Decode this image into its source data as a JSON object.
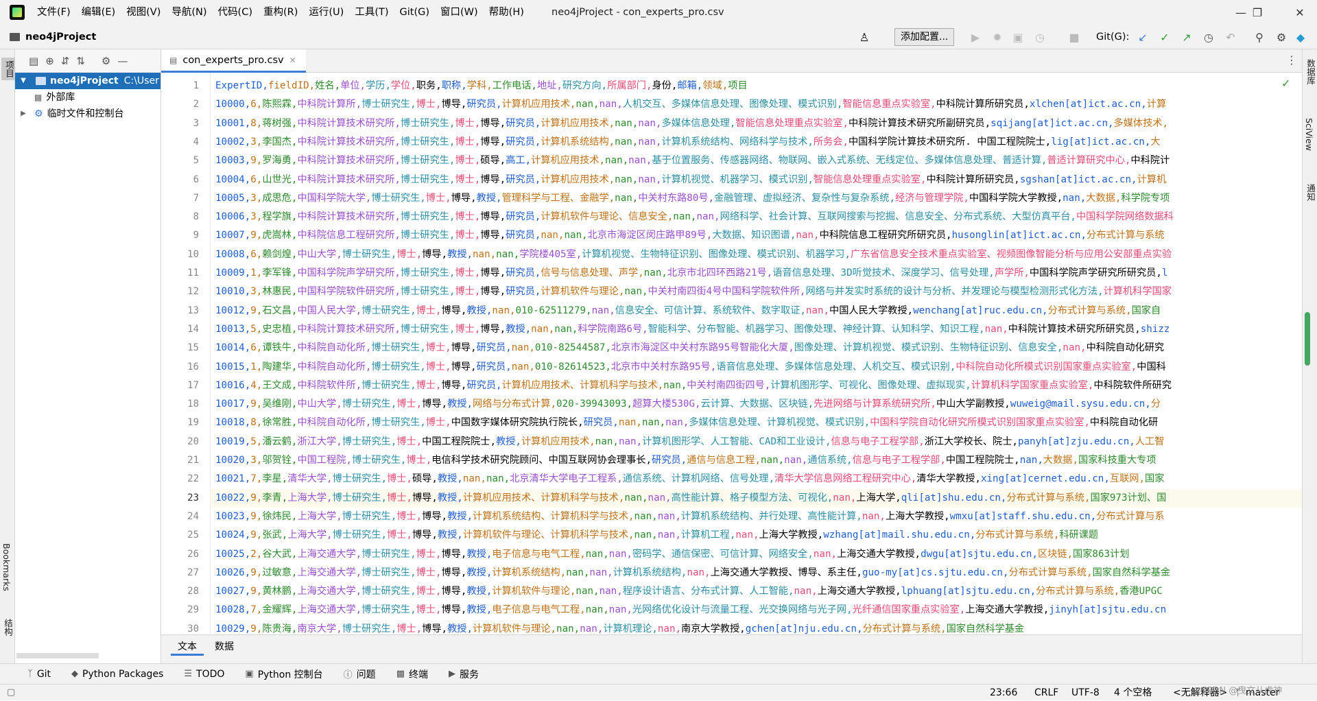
{
  "menubar": {
    "items": [
      "文件(F)",
      "编辑(E)",
      "视图(V)",
      "导航(N)",
      "代码(C)",
      "重构(R)",
      "运行(U)",
      "工具(T)",
      "Git(G)",
      "窗口(W)",
      "帮助(H)"
    ],
    "title": "neo4jProject - con_experts_pro.csv"
  },
  "navbar": {
    "project": "neo4jProject",
    "config_button": "添加配置...",
    "git_label": "Git(G):"
  },
  "left_strip": {
    "project": "项目",
    "bookmarks": "Bookmarks",
    "structure": "结构"
  },
  "right_strip": {
    "database": "数据库",
    "sciview": "SciView",
    "notifications": "通知"
  },
  "project_tree": {
    "root": "neo4jProject",
    "root_path": "C:\\User",
    "ext_libs": "外部库",
    "scratches": "临时文件和控制台"
  },
  "editor": {
    "file_tab": "con_experts_pro.csv",
    "current_line": 23,
    "lines": [
      "ExpertID,fieldID,姓名,单位,学历,学位,职务,职称,学科,工作电话,地址,研究方向,所属部门,身份,邮箱,领域,项目",
      "10000,6,陈熙霖,中科院计算所,博士研究生,博士,博导,研究员,计算机应用技术,nan,nan,人机交互、多媒体信息处理、图像处理、模式识别,智能信息重点实验室,中科院计算所研究员,xlchen[at]ict.ac.cn,计算",
      "10001,8,蒋树强,中科院计算技术研究所,博士研究生,博士,博导,研究员,计算机应用技术,nan,nan,多媒体信息处理,智能信息处理重点实验室,中科院计算技术研究所副研究员,sqijang[at]ict.ac.cn,多媒体技术,",
      "10002,3,李国杰,中科院计算技术研究所,博士研究生,博士,博导,研究员,计算机系统结构,nan,nan,计算机系统结构、网络科学与技术,所务会,中国科学院计算技术研究所. 中国工程院院士,lig[at]ict.ac.cn,大",
      "10003,9,罗海勇,中科院计算技术研究所,博士研究生,博士,硕导,高工,计算机应用技术,nan,nan,基于位置服务、传感器网络、物联网、嵌入式系统、无线定位、多媒体信息处理、普适计算,普适计算研究中心,中科院计",
      "10004,6,山世光,中科院计算技术研究所,博士研究生,博士,博导,研究员,计算机应用技术,nan,nan,计算机视觉、机器学习、模式识别,智能信息处理重点实验室,中科院计算所研究员,sgshan[at]ict.ac.cn,计算机",
      "10005,3,成思危,中国科学院大学,博士研究生,博士,博导,教授,管理科学与工程、金融学,nan,中关村东路80号,金融管理、虚拟经济、复杂性与复杂系统,经济与管理学院,中国科学院大学教授,nan,大数据,科学院专项",
      "10006,3,程学旗,中科院计算技术研究所,博士研究生,博士,博导,研究员,计算机软件与理论、信息安全,nan,nan,网络科学、社会计算、互联网搜索与挖掘、信息安全、分布式系统、大型仿真平台,中国科学院网络数据科",
      "10007,9,虎嵩林,中科院信息工程研究所,博士研究生,博士,博导,研究员,nan,nan,北京市海淀区闵庄路甲89号,大数据、知识图谱,nan,中科院信息工程研究所研究员,husonglin[at]ict.ac.cn,分布式计算与系统",
      "10008,6,赖剑煌,中山大学,博士研究生,博士,博导,教授,nan,nan,学院楼405室,计算机视觉、生物特征识别、图像处理、模式识别、机器学习,广东省信息安全技术重点实验室、视频图像智能分析与应用公安部重点实验",
      "10009,1,李军锋,中国科学院声学研究所,博士研究生,博士,博导,研究员,信号与信息处理、声学,nan,北京市北四环西路21号,语音信息处理、3D听觉技术、深度学习、信号处理,声学所,中国科学院声学研究所研究员,l",
      "10010,3,林惠民,中国科学院软件研究所,博士研究生,博士,博导,研究员,计算机软件与理论,nan,中关村南四街4号中国科学院软件所,网络与并发实时系统的设计与分析、并发理论与模型检测形式化方法,计算机科学国家",
      "10012,9,石文昌,中国人民大学,博士研究生,博士,博导,教授,nan,010-62511279,nan,信息安全、可信计算、系统软件、数字取证,nan,中国人民大学教授,wenchang[at]ruc.edu.cn,分布式计算与系统,国家自",
      "10013,5,史忠植,中科院计算技术研究所,博士研究生,博士,博导,教授,nan,nan,科学院南路6号,智能科学、分布智能、机器学习、图像处理、神经计算、认知科学、知识工程,nan,中科院计算技术研究所研究员,shizz",
      "10014,6,谭铁牛,中科院自动化所,博士研究生,博士,博导,研究员,nan,010-82544587,北京市海淀区中关村东路95号智能化大厦,图像处理、计算机视觉、模式识别、生物特征识别、信息安全,nan,中科院自动化研究",
      "10015,1,陶建华,中科院自动化所,博士研究生,博士,博导,研究员,nan,010-82614523,北京市中关村东路95号,语音信息处理、多媒体信息处理、人机交互、模式识别,中科院自动化所模式识别国家重点实验室,中国科",
      "10016,4,王文成,中科院软件所,博士研究生,博士,博导,研究员,计算机应用技术、计算机科学与技术,nan,中关村南四街四号,计算机图形学、可视化、图像处理、虚拟现实,计算机科学国家重点实验室,中科院软件所研究",
      "10017,9,吴维刚,中山大学,博士研究生,博士,博导,教授,网络与分布式计算,020-39943093,超算大楼530G,云计算、大数据、区块链,先进网络与计算系统研究所,中山大学副教授,wuweig@mail.sysu.edu.cn,分",
      "10018,8,徐常胜,中科院自动化所,博士研究生,博士,中国数字媒体研究院执行院长,研究员,nan,nan,nan,多媒体信息处理、计算机视觉、模式识别,中国科学院自动化研究所模式识别国家重点实验室,中科院自动化研",
      "10019,5,潘云鹤,浙江大学,博士研究生,博士,中国工程院院士,教授,计算机应用技术,nan,nan,计算机图形学、人工智能、CAD和工业设计,信息与电子工程学部,浙江大学校长、院士,panyh[at]zju.edu.cn,人工智",
      "10020,3,邬贺铨,中国工程院,博士研究生,博士,电信科学技术研究院顾问、中国互联网协会理事长,研究员,通信与信息工程,nan,nan,通信系统,信息与电子工程学部,中国工程院院士,nan,大数据,国家科技重大专项",
      "10021,7,李星,清华大学,博士研究生,博士,硕导,教授,nan,nan,北京清华大学电子工程系,通信系统、计算机网络、信号处理,清华大学信息网络工程研究中心,清华大学教授,xing[at]cernet.edu.cn,互联网,国家",
      "10022,9,李青,上海大学,博士研究生,博士,博导,教授,计算机应用技术、计算机科学与技术,nan,nan,高性能计算、格子模型方法、可视化,nan,上海大学,qli[at]shu.edu.cn,分布式计算与系统,国家973计划、国",
      "10023,9,徐炜民,上海大学,博士研究生,博士,博导,教授,计算机系统结构、计算机科学与技术,nan,nan,计算机系统结构、并行处理、高性能计算,nan,上海大学教授,wmxu[at]staff.shu.edu.cn,分布式计算与系",
      "10024,9,张武,上海大学,博士研究生,博士,博导,教授,计算机软件与理论、计算机科学与技术,nan,nan,计算机工程,nan,上海大学教授,wzhang[at]mail.shu.edu.cn,分布式计算与系统,科研课题",
      "10025,2,谷大武,上海交通大学,博士研究生,博士,博导,教授,电子信息与电气工程,nan,nan,密码学、通信保密、可信计算、网络安全,nan,上海交通大学教授,dwgu[at]sjtu.edu.cn,区块链,国家863计划",
      "10026,9,过敏意,上海交通大学,博士研究生,博士,博导,教授,计算机系统结构,nan,nan,计算机系统结构,nan,上海交通大学教授、博导、系主任,guo-my[at]cs.sjtu.edu.cn,分布式计算与系统,国家自然科学基金",
      "10027,9,黄林鹏,上海交通大学,博士研究生,博士,博导,教授,计算机软件与理论,nan,nan,程序设计语言、分布式计算、人工智能,nan,上海交通大学教授,lphuang[at]sjtu.edu.cn,分布式计算与系统,香港UPGC",
      "10028,7,金耀辉,上海交通大学,博士研究生,博士,博导,教授,电子信息与电气工程,nan,nan,光网络优化设计与流量工程、光交换网络与光子网,光纤通信国家重点实验室,上海交通大学教授,jinyh[at]sjtu.edu.cn",
      "10029,9,陈贵海,南京大学,博士研究生,博士,博导,教授,计算机软件与理论,nan,nan,计算机理论,nan,南京大学教授,gchen[at]nju.edu.cn,分布式计算与系统,国家自然科学基金"
    ]
  },
  "bottom_tabs": {
    "text": "文本",
    "data": "数据"
  },
  "tool_windows": [
    "Git",
    "Python Packages",
    "TODO",
    "Python 控制台",
    "问题",
    "终端",
    "服务"
  ],
  "status": {
    "position": "23:66",
    "line_sep": "CRLF",
    "encoding": "UTF-8",
    "indent": "4 个空格",
    "interpreter": "<无解释器>",
    "branch": "master",
    "watermark": "CSDN @曳文从虎神"
  },
  "colors": {
    "selection": "#1e6fb8",
    "accent": "#3d7bd9",
    "csv_columns": [
      "#1f5fcf",
      "#c1721a",
      "#2d8c2d",
      "#9c4fcf",
      "#2e8fa8",
      "#e34d76",
      "#000000"
    ]
  }
}
